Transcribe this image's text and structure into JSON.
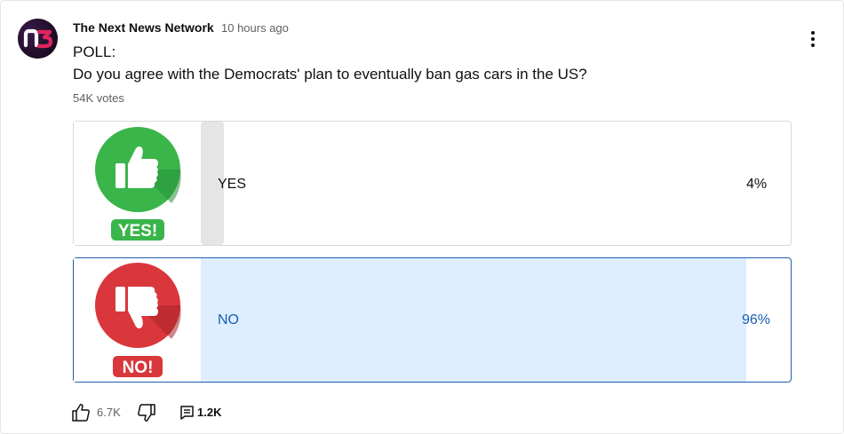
{
  "post": {
    "author": "The Next News Network",
    "time": "10 hours ago",
    "avatar_text": "n3",
    "line1": "POLL:",
    "line2": "Do you agree with the Democrats' plan to eventually ban gas cars in the US?",
    "votes": "54K votes"
  },
  "poll": {
    "options": [
      {
        "label": "YES",
        "percent": "4%",
        "value": 4,
        "badge": "YES!",
        "icon": "thumbs-up-icon",
        "color": "#3cb54a",
        "selected": false
      },
      {
        "label": "NO",
        "percent": "96%",
        "value": 96,
        "badge": "NO!",
        "icon": "thumbs-down-icon",
        "color": "#d9373c",
        "selected": true
      }
    ]
  },
  "actions": {
    "likes": "6.7K",
    "replies": "1.2K",
    "like_icon": "thumb-up-outline-icon",
    "dislike_icon": "thumb-down-outline-icon",
    "comment_icon": "comment-icon"
  },
  "menu_icon": "more-vert-icon"
}
